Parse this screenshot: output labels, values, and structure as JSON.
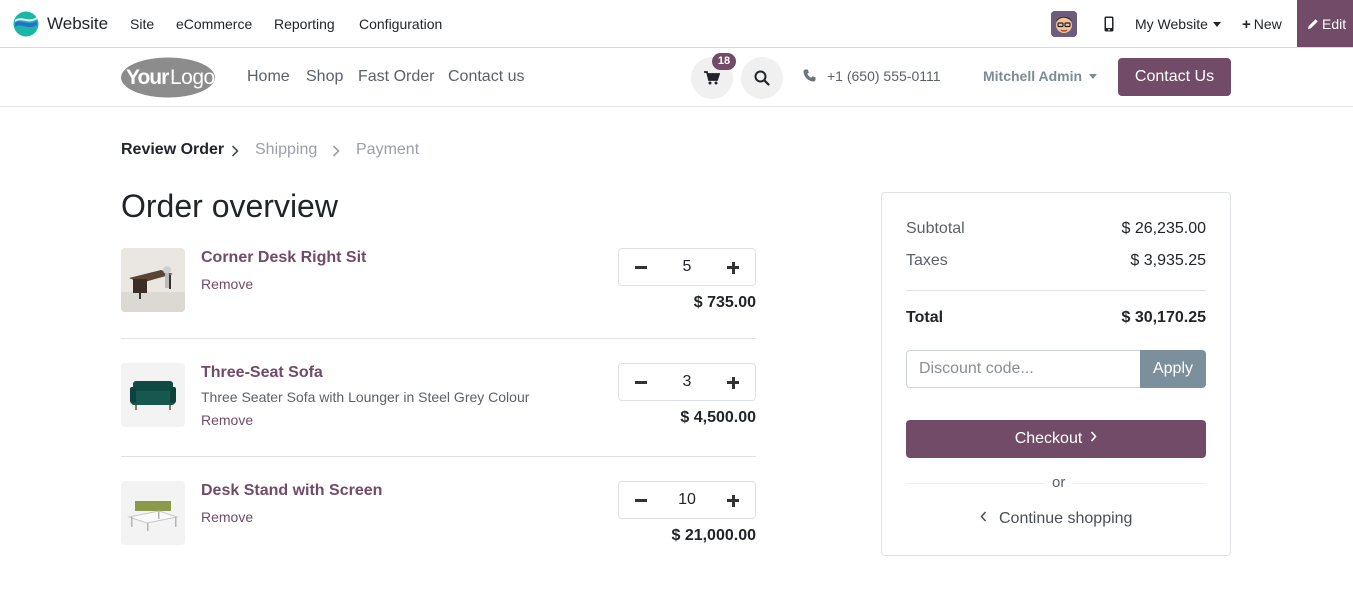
{
  "admin_bar": {
    "app_name": "Website",
    "menu": [
      "Site",
      "eCommerce",
      "Reporting",
      "Configuration"
    ],
    "website_switcher": "My Website",
    "new_label": "New",
    "edit_label": "Edit",
    "icons": {
      "app": "website-app-icon",
      "mobile": "mobile-preview-icon",
      "avatar": "user-avatar"
    }
  },
  "site_header": {
    "logo_text": "YourLogo",
    "nav": [
      "Home",
      "Shop",
      "Fast Order",
      "Contact us"
    ],
    "cart_count": "18",
    "phone": "+1 (650) 555-0111",
    "user_name": "Mitchell Admin",
    "contact_button": "Contact Us"
  },
  "checkout_steps": [
    {
      "label": "Review Order",
      "active": true
    },
    {
      "label": "Shipping",
      "active": false
    },
    {
      "label": "Payment",
      "active": false
    }
  ],
  "order": {
    "title": "Order overview",
    "remove_label": "Remove",
    "lines": [
      {
        "name": "Corner Desk Right Sit",
        "description": "",
        "quantity": "5",
        "price": "$ 735.00"
      },
      {
        "name": "Three-Seat Sofa",
        "description": "Three Seater Sofa with Lounger in Steel Grey Colour",
        "quantity": "3",
        "price": "$ 4,500.00"
      },
      {
        "name": "Desk Stand with Screen",
        "description": "",
        "quantity": "10",
        "price": "$ 21,000.00"
      }
    ]
  },
  "summary": {
    "subtotal_label": "Subtotal",
    "subtotal": "$ 26,235.00",
    "taxes_label": "Taxes",
    "taxes": "$ 3,935.25",
    "total_label": "Total",
    "total": "$ 30,170.25",
    "discount_placeholder": "Discount code...",
    "apply_label": "Apply",
    "checkout_label": "Checkout",
    "or_label": "or",
    "continue_label": "Continue shopping"
  },
  "colors": {
    "brand": "#714b67",
    "apply_button": "#7b8f9c",
    "muted_text": "#5b616a"
  }
}
